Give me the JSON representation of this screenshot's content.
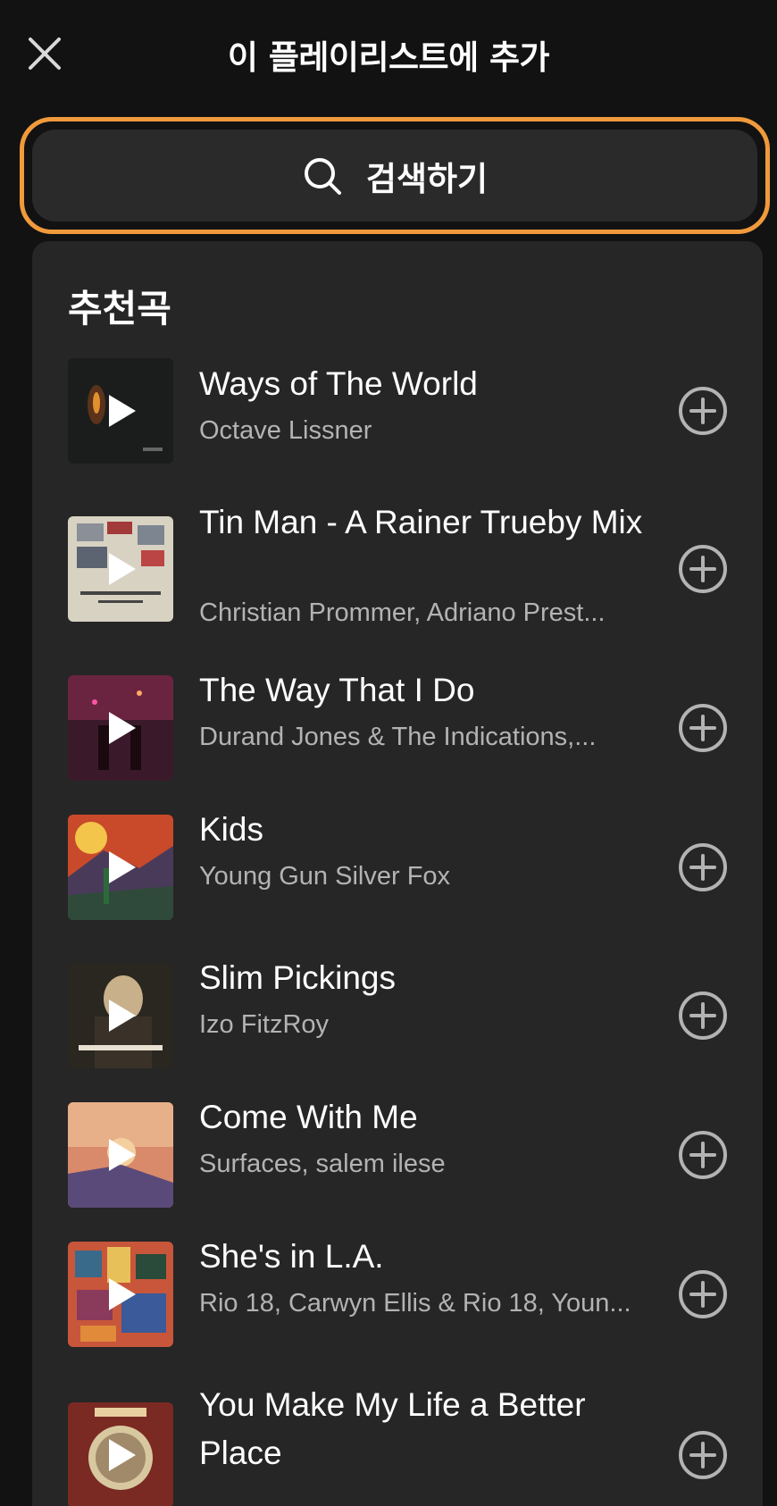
{
  "header": {
    "title": "이 플레이리스트에 추가"
  },
  "search": {
    "label": "검색하기"
  },
  "recommended": {
    "heading": "추천곡",
    "tracks": [
      {
        "title": "Ways of The World",
        "artist": "Octave Lissner"
      },
      {
        "title": "Tin Man - A Rainer Trueby Mix",
        "artist": "Christian Prommer, Adriano Prest..."
      },
      {
        "title": "The Way That I Do",
        "artist": "Durand Jones & The Indications,..."
      },
      {
        "title": "Kids",
        "artist": "Young Gun Silver Fox"
      },
      {
        "title": "Slim Pickings",
        "artist": "Izo FitzRoy"
      },
      {
        "title": "Come With Me",
        "artist": "Surfaces, salem ilese"
      },
      {
        "title": "She's in L.A.",
        "artist": "Rio 18, Carwyn Ellis & Rio 18, Youn..."
      },
      {
        "title": "You Make My Life a Better Place",
        "artist": ""
      }
    ]
  },
  "icons": {
    "close": "close-icon",
    "search": "search-icon",
    "play": "play-icon",
    "add": "plus-circle-icon"
  },
  "colors": {
    "background": "#121212",
    "panel": "#262626",
    "search_focus_border": "#f09a3c",
    "secondary_text": "#b3b3b3"
  }
}
